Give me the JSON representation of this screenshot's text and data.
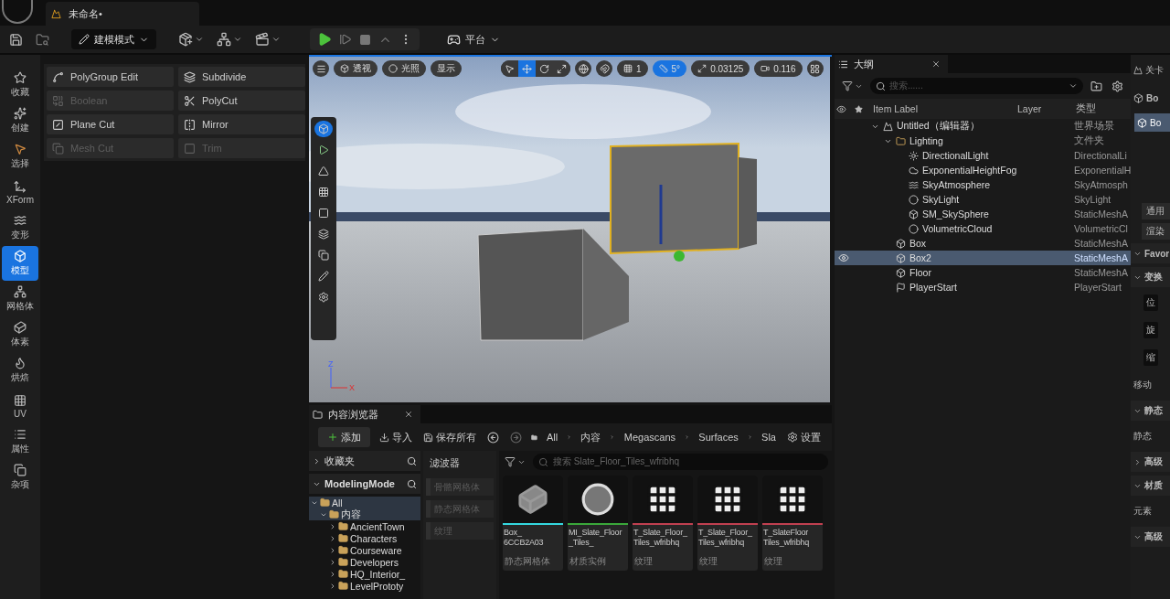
{
  "title_bar": {
    "tab": "未命名•"
  },
  "toolbar": {
    "mode": "建模模式",
    "platform": "平台"
  },
  "mode_rail": [
    {
      "label": "收藏",
      "kind": "star",
      "selected": false
    },
    {
      "label": "创建",
      "kind": "create",
      "selected": false
    },
    {
      "label": "选择",
      "kind": "select",
      "selected": false
    },
    {
      "label": "XForm",
      "kind": "xform",
      "selected": false
    },
    {
      "label": "变形",
      "kind": "deform",
      "selected": false
    },
    {
      "label": "模型",
      "kind": "model",
      "selected": true
    },
    {
      "label": "网格体",
      "kind": "mesh",
      "selected": false
    },
    {
      "label": "体素",
      "kind": "voxel",
      "selected": false
    },
    {
      "label": "烘焙",
      "kind": "bake",
      "selected": false
    },
    {
      "label": "UV",
      "kind": "uv",
      "selected": false
    },
    {
      "label": "属性",
      "kind": "attributes",
      "selected": false
    },
    {
      "label": "杂项",
      "kind": "misc",
      "selected": false
    }
  ],
  "tools": [
    {
      "label": "PolyGroup Edit",
      "kind": "polygroup",
      "disabled": false
    },
    {
      "label": "Subdivide",
      "kind": "subdivide",
      "disabled": false
    },
    {
      "label": "Boolean",
      "kind": "boolean",
      "disabled": true
    },
    {
      "label": "PolyCut",
      "kind": "polycut",
      "disabled": false
    },
    {
      "label": "Plane Cut",
      "kind": "planecut",
      "disabled": false
    },
    {
      "label": "Mirror",
      "kind": "mirror",
      "disabled": false
    },
    {
      "label": "Mesh Cut",
      "kind": "meshcut",
      "disabled": true
    },
    {
      "label": "Trim",
      "kind": "trim",
      "disabled": true
    }
  ],
  "viewport": {
    "view_buttons": [
      "透视",
      "光照",
      "显示"
    ],
    "transform_tools": [
      {
        "kind": "select",
        "selected": false
      },
      {
        "kind": "move",
        "selected": true
      },
      {
        "kind": "rotate",
        "selected": false
      },
      {
        "kind": "scale",
        "selected": false
      }
    ],
    "grid_snap": "1",
    "angle_snap": "5°",
    "angle_snap_on": true,
    "scale_snap": "0.03125",
    "camera_speed": "0.116",
    "axis_labels": [
      "Z",
      "X"
    ]
  },
  "outliner": {
    "tab": "大纲",
    "search_placeholder": "搜索......",
    "columns": [
      "Item Label",
      "Layer",
      "类型"
    ],
    "rows": [
      {
        "label": "Untitled（编辑器）",
        "type": "世界场景",
        "kind": "world",
        "selected": false,
        "expanded": true,
        "children": [
          {
            "label": "Lighting",
            "type": "文件夹",
            "kind": "folder",
            "selected": false,
            "expanded": true,
            "children": [
              {
                "label": "DirectionalLight",
                "type": "DirectionalLi",
                "kind": "sun",
                "selected": false
              },
              {
                "label": "ExponentialHeightFog",
                "type": "ExponentialH",
                "kind": "fog",
                "selected": false
              },
              {
                "label": "SkyAtmosphere",
                "type": "SkyAtmosph",
                "kind": "atmosphere",
                "selected": false
              },
              {
                "label": "SkyLight",
                "type": "SkyLight",
                "kind": "dome",
                "selected": false
              },
              {
                "label": "SM_SkySphere",
                "type": "StaticMeshA",
                "kind": "mesh",
                "selected": false
              },
              {
                "label": "VolumetricCloud",
                "type": "VolumetricCl",
                "kind": "dome",
                "selected": false
              }
            ]
          },
          {
            "label": "Box",
            "type": "StaticMeshA",
            "kind": "mesh",
            "selected": false
          },
          {
            "label": "Box2",
            "type": "StaticMeshA",
            "kind": "mesh",
            "selected": true
          },
          {
            "label": "Floor",
            "type": "StaticMeshA",
            "kind": "mesh",
            "selected": false
          },
          {
            "label": "PlayerStart",
            "type": "PlayerStart",
            "kind": "start",
            "selected": false
          }
        ]
      }
    ]
  },
  "details": {
    "tab": "关卡",
    "header": "Bo",
    "component": "Bo",
    "buttons": [
      "通用",
      "渲染"
    ],
    "sections": [
      {
        "label": "Favor",
        "kind": "section"
      },
      {
        "label": "变换",
        "kind": "section"
      },
      {
        "label": "位",
        "kind": "field"
      },
      {
        "label": "旋",
        "kind": "field"
      },
      {
        "label": "缩",
        "kind": "field"
      },
      {
        "label": "移动",
        "kind": "text"
      },
      {
        "label": "静态",
        "kind": "section"
      },
      {
        "label": "静态",
        "kind": "text"
      },
      {
        "label": "高级",
        "kind": "collapsed"
      },
      {
        "label": "材质",
        "kind": "section"
      },
      {
        "label": "元素",
        "kind": "text"
      },
      {
        "label": "高级",
        "kind": "section"
      }
    ]
  },
  "content_browser": {
    "tab": "内容浏览器",
    "add": "添加",
    "import": "导入",
    "save_all": "保存所有",
    "breadcrumbs": [
      "All",
      "内容",
      "Megascans",
      "Surfaces",
      "Sla"
    ],
    "settings": "设置",
    "favorites": "收藏夹",
    "collection": "ModelingMode",
    "tree": [
      {
        "label": "All",
        "selected": true,
        "expanded": true,
        "children": [
          {
            "label": "内容",
            "selected": true,
            "expanded": true,
            "children": [
              {
                "label": "AncientTown",
                "selected": false,
                "expanded": false
              },
              {
                "label": "Characters",
                "selected": false,
                "expanded": false
              },
              {
                "label": "Courseware",
                "selected": false,
                "expanded": false
              },
              {
                "label": "Developers",
                "selected": false,
                "expanded": false
              },
              {
                "label": "HQ_Interior_",
                "selected": false,
                "expanded": false
              },
              {
                "label": "LevelPrototy",
                "selected": false,
                "expanded": false
              }
            ]
          }
        ]
      }
    ],
    "filters_title": "滤波器",
    "filters": [
      "骨骼网格体",
      "静态网格体",
      "纹理"
    ],
    "search_placeholder": "搜索 Slate_Floor_Tiles_wfribhq",
    "assets": [
      {
        "name": "Box_ 6CCB2A03",
        "type": "静态网格体",
        "kind": "mesh",
        "color": "#34d8e0"
      },
      {
        "name": "MI_Slate_Floor _Tiles_",
        "type": "材质实例",
        "kind": "material",
        "color": "#3aa83a"
      },
      {
        "name": "T_Slate_Floor_ Tiles_wfribhq",
        "type": "纹理",
        "kind": "texture",
        "color": "#c04050"
      },
      {
        "name": "T_Slate_Floor_ Tiles_wfribhq",
        "type": "纹理",
        "kind": "texture",
        "color": "#c04050"
      },
      {
        "name": "T_SlateFloor Tiles_wfribhq",
        "type": "纹理",
        "kind": "texture",
        "color": "#c04050"
      }
    ]
  }
}
